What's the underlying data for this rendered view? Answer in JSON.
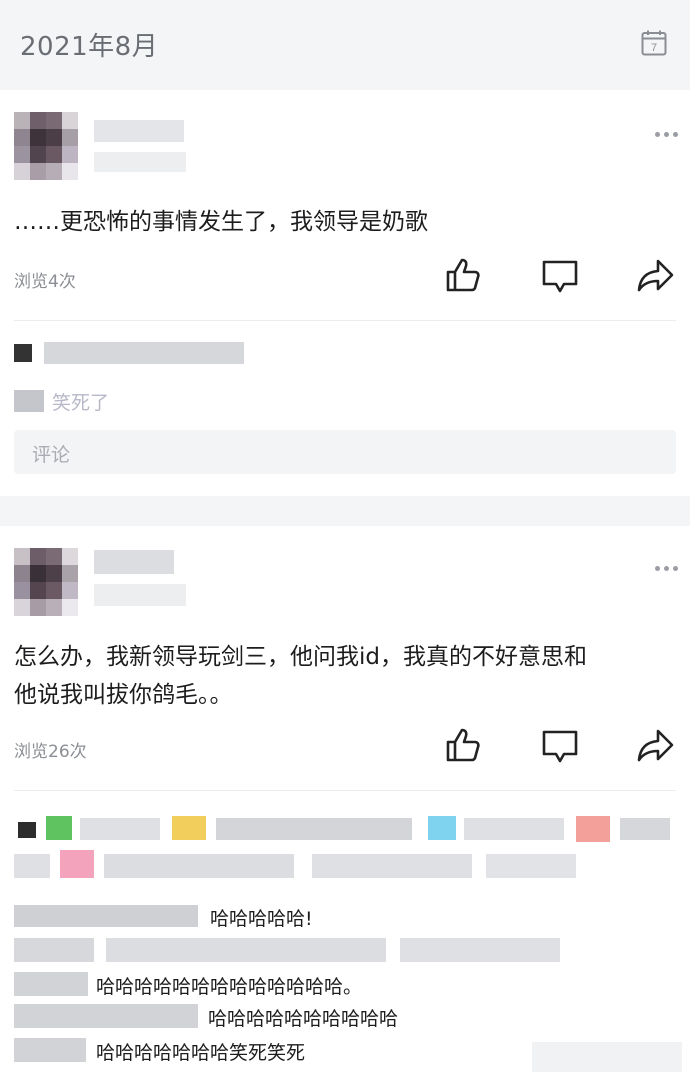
{
  "header": {
    "title": "2021年8月",
    "calendar_icon": "calendar-icon",
    "calendar_day": "7"
  },
  "posts": [
    {
      "text": "……更恐怖的事情发生了，我领导是奶歌",
      "views": "浏览4次",
      "comments": [
        {
          "text": "笑死了"
        }
      ],
      "comment_placeholder": "评论"
    },
    {
      "text_line1": "怎么办，我新领导玩剑三，他问我id，我真的不好意思和",
      "text_line2": "他说我叫拔你鸽毛。。",
      "views": "浏览26次",
      "replies": [
        "哈哈哈哈哈!",
        "哈哈哈哈哈哈哈哈哈哈哈哈哈。",
        "哈哈哈哈哈哈哈哈哈哈",
        "哈哈哈哈哈哈哈笑死笑死"
      ]
    }
  ],
  "icons": [
    "more-icon",
    "like-icon",
    "comment-icon",
    "share-icon"
  ],
  "colors": {
    "background": "#f4f5f7",
    "card": "#ffffff",
    "muted_text": "#8b8e94"
  }
}
